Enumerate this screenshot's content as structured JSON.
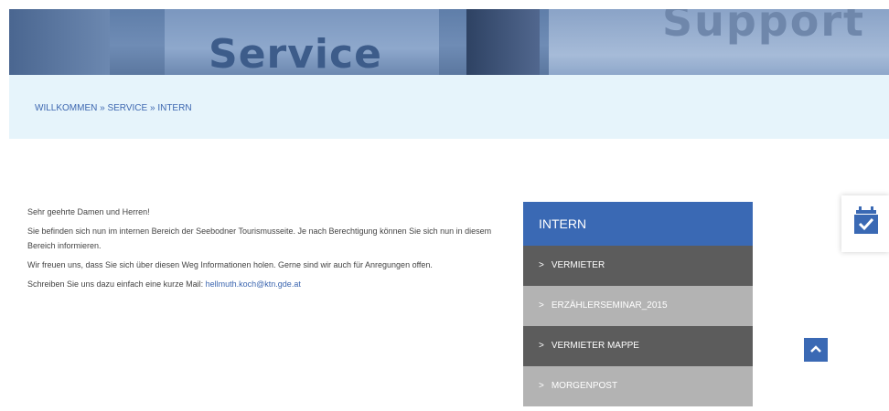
{
  "hero": {
    "service_word": "Service",
    "support_word": "Support"
  },
  "breadcrumb": {
    "items": [
      "WILLKOMMEN",
      "SERVICE",
      "INTERN"
    ],
    "separator": "»"
  },
  "content": {
    "greeting": "Sehr geehrte Damen und Herren!",
    "paragraph1": "Sie befinden sich nun im internen Bereich der Seebodner Tourismusseite. Je nach Berechtigung können Sie sich nun in diesem Bereich informieren.",
    "paragraph2": "Wir freuen uns, dass Sie sich über diesen Weg Informationen holen. Gerne sind wir auch für Anregungen offen.",
    "paragraph3_prefix": "Schreiben Sie uns dazu einfach eine kurze Mail: ",
    "email": "hellmuth.koch@ktn.gde.at"
  },
  "sidemenu": {
    "title": "INTERN",
    "items": [
      {
        "label": "VERMIETER",
        "shade": "dark"
      },
      {
        "label": "ERZÄHLERSEMINAR_2015",
        "shade": "light"
      },
      {
        "label": "VERMIETER MAPPE",
        "shade": "dark"
      },
      {
        "label": "MORGENPOST",
        "shade": "light"
      }
    ]
  },
  "icons": {
    "calendar": "calendar-check-icon",
    "scroll_up": "chevron-up-icon"
  },
  "colors": {
    "accent": "#3a69b4",
    "breadcrumb_bg": "#e6f4fb",
    "menu_dark": "#5c5c5c",
    "menu_light": "#b3b3b3",
    "link": "#3d67b0"
  }
}
